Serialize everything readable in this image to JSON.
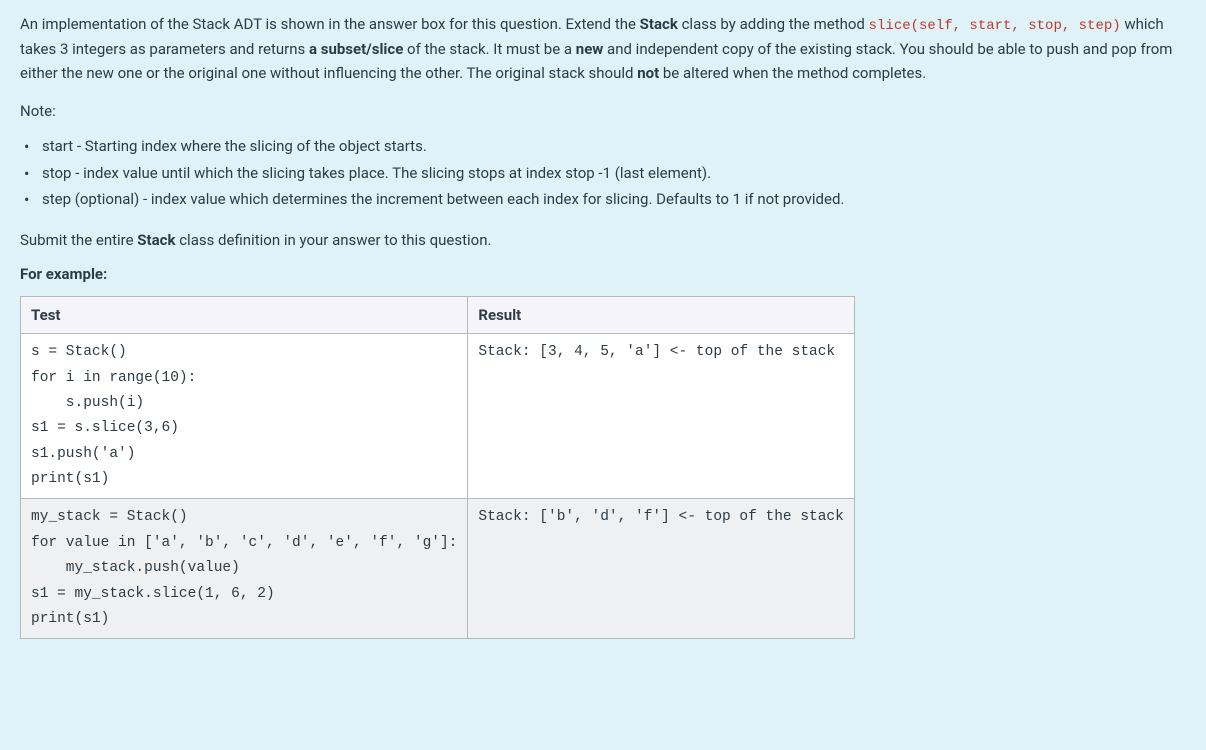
{
  "intro": {
    "part1": "An implementation of the Stack ADT is shown in the answer box for this question. Extend the ",
    "stack_bold": "Stack",
    "part2": " class by adding the method ",
    "method_code": "slice(self, start, stop, step)",
    "part3": " which takes 3 integers as parameters and returns ",
    "subset_bold": "a subset/slice",
    "part4": " of the stack. It must be a ",
    "new_bold": "new",
    "part5": " and independent copy of the existing stack. You should be able to push and pop from either the new one or the original one without influencing the other. The original stack should ",
    "not_bold": "not",
    "part6": " be altered when the method completes."
  },
  "note_label": "Note:",
  "notes": [
    "start - Starting index where the slicing of the object starts.",
    "stop - index value until which the slicing takes place. The slicing stops at index stop -1 (last element).",
    "step (optional) - index value which determines the increment between each index for slicing. Defaults to 1 if not provided."
  ],
  "submit": {
    "part1": "Submit the entire ",
    "stack_bold": "Stack",
    "part2": " class definition in your answer to this question."
  },
  "example_label": "For example:",
  "table": {
    "headers": {
      "test": "Test",
      "result": "Result"
    },
    "rows": [
      {
        "test": "s = Stack()\nfor i in range(10):\n    s.push(i)\ns1 = s.slice(3,6)\ns1.push('a')\nprint(s1)",
        "result": "Stack: [3, 4, 5, 'a'] <- top of the stack"
      },
      {
        "test": "my_stack = Stack()\nfor value in ['a', 'b', 'c', 'd', 'e', 'f', 'g']:\n    my_stack.push(value)\ns1 = my_stack.slice(1, 6, 2)\nprint(s1)",
        "result": "Stack: ['b', 'd', 'f'] <- top of the stack"
      }
    ]
  }
}
